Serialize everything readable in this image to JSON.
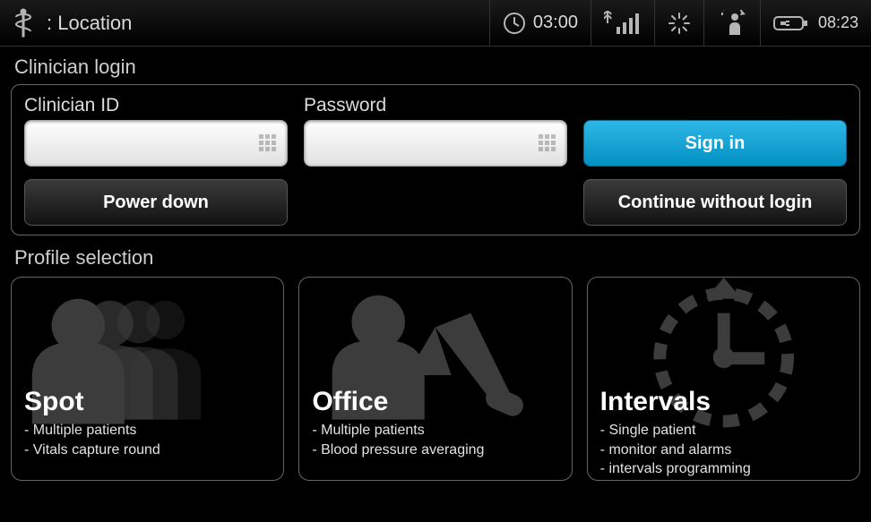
{
  "statusbar": {
    "location_label": ": Location",
    "timer": "03:00",
    "battery_time": "08:23"
  },
  "login": {
    "section_title": "Clinician login",
    "clinician_id_label": "Clinician ID",
    "clinician_id_value": "",
    "password_label": "Password",
    "password_value": "",
    "signin_label": "Sign in",
    "power_down_label": "Power down",
    "continue_label": "Continue without login"
  },
  "profiles": {
    "section_title": "Profile selection",
    "items": [
      {
        "title": "Spot",
        "lines": [
          "Multiple patients",
          "Vitals capture round"
        ]
      },
      {
        "title": "Office",
        "lines": [
          "Multiple patients",
          "Blood pressure averaging"
        ]
      },
      {
        "title": "Intervals",
        "lines": [
          "Single patient",
          "monitor and alarms",
          "intervals programming"
        ]
      }
    ]
  }
}
